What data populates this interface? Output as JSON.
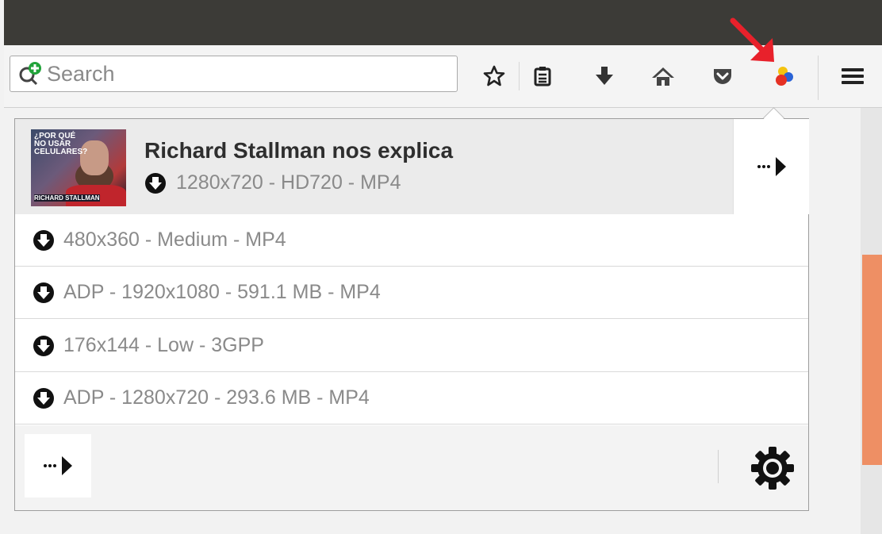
{
  "search": {
    "placeholder": "Search"
  },
  "video": {
    "thumbnail_text": "¿POR QUÉ NO USAR CELULARES?",
    "thumbnail_caption": "RICHARD STALLMAN",
    "title": "Richard Stallman nos explica",
    "main_format": "1280x720 - HD720 - MP4"
  },
  "formats": [
    {
      "label": "480x360 - Medium - MP4"
    },
    {
      "label": "ADP - 1920x1080 - 591.1 MB - MP4"
    },
    {
      "label": "176x144 - Low - 3GPP"
    },
    {
      "label": "ADP - 1280x720 - 293.6 MB - MP4"
    }
  ],
  "icons": {
    "toolbar": [
      "star-icon",
      "reading-list-icon",
      "download-icon",
      "home-icon",
      "pocket-icon",
      "video-downloadhelper-icon",
      "hamburger-menu-icon"
    ],
    "annotation": "red-arrow-icon"
  },
  "colors": {
    "topbar": "#3c3b37",
    "accent_orange": "#ee8f64",
    "annotation_red": "#e8212b"
  }
}
